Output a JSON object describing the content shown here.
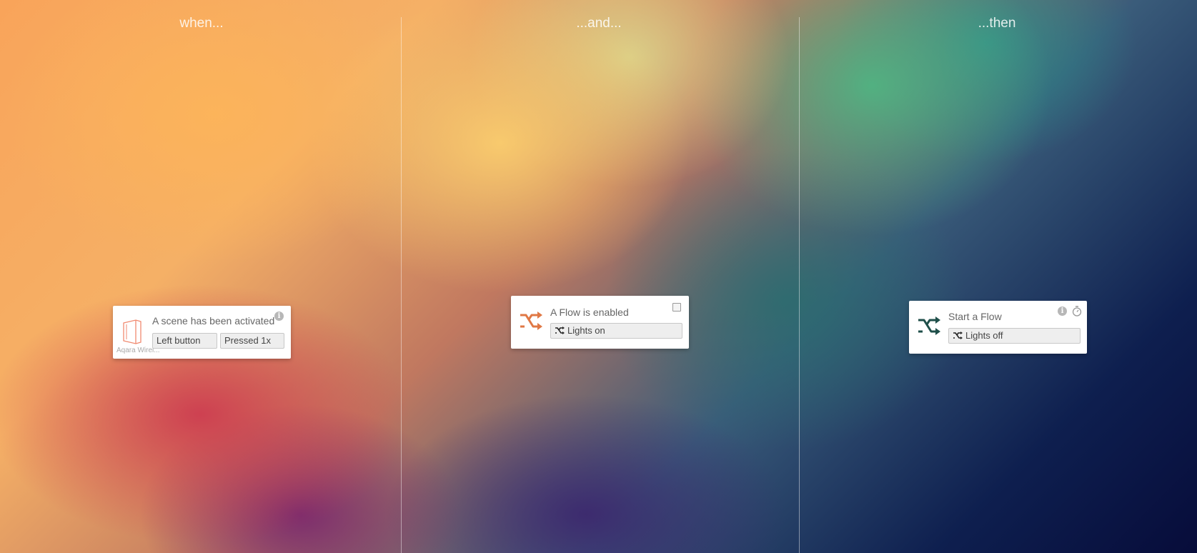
{
  "columns": {
    "when": "when...",
    "and": "...and...",
    "then": "...then"
  },
  "when_card": {
    "title": "A scene has been activated",
    "device_label": "Aqara Wirel...",
    "button_field": "Left button",
    "press_field": "Pressed 1x",
    "icon": "aqara-switch-icon",
    "icon_color": "#f08a70"
  },
  "and_card": {
    "title": "A Flow is enabled",
    "flow_field": "Lights on",
    "icon": "flow-icon",
    "icon_color": "#e07845"
  },
  "then_card": {
    "title": "Start a Flow",
    "flow_field": "Lights off",
    "icon": "flow-icon",
    "icon_color": "#1f4f4a"
  },
  "colors": {
    "divider": "#ffffff",
    "card": "#ffffff"
  }
}
